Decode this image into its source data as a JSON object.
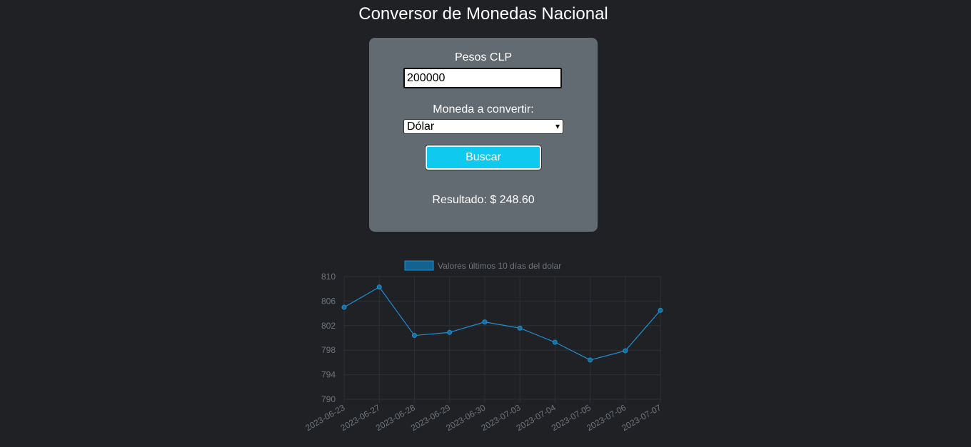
{
  "header": {
    "title": "Conversor de Monedas Nacional"
  },
  "converter": {
    "amount_label": "Pesos CLP",
    "amount_value": "200000",
    "currency_label": "Moneda a convertir:",
    "currency_selected": "Dólar",
    "search_button": "Buscar",
    "result_text": "Resultado: $ 248.60"
  },
  "colors": {
    "background": "#1f2124",
    "card": "#626b72",
    "button": "#10c9ef",
    "line": "#1f8fd0"
  },
  "icons": {
    "select_arrow": "chevron-down-icon"
  },
  "chart_data": {
    "type": "line",
    "legend": "top",
    "grid": true,
    "categories": [
      "2023-06-23",
      "2023-06-27",
      "2023-06-28",
      "2023-06-29",
      "2023-06-30",
      "2023-07-03",
      "2023-07-04",
      "2023-07-05",
      "2023-07-06",
      "2023-07-07"
    ],
    "series": [
      {
        "name": "Valores últimos 10 días del dolar",
        "values": [
          805.0,
          808.3,
          800.4,
          800.9,
          802.6,
          801.6,
          799.3,
          796.4,
          797.9,
          804.5
        ]
      }
    ],
    "ylim": [
      790,
      810
    ],
    "yticks": [
      "810",
      "806",
      "802",
      "798",
      "794",
      "790"
    ]
  }
}
